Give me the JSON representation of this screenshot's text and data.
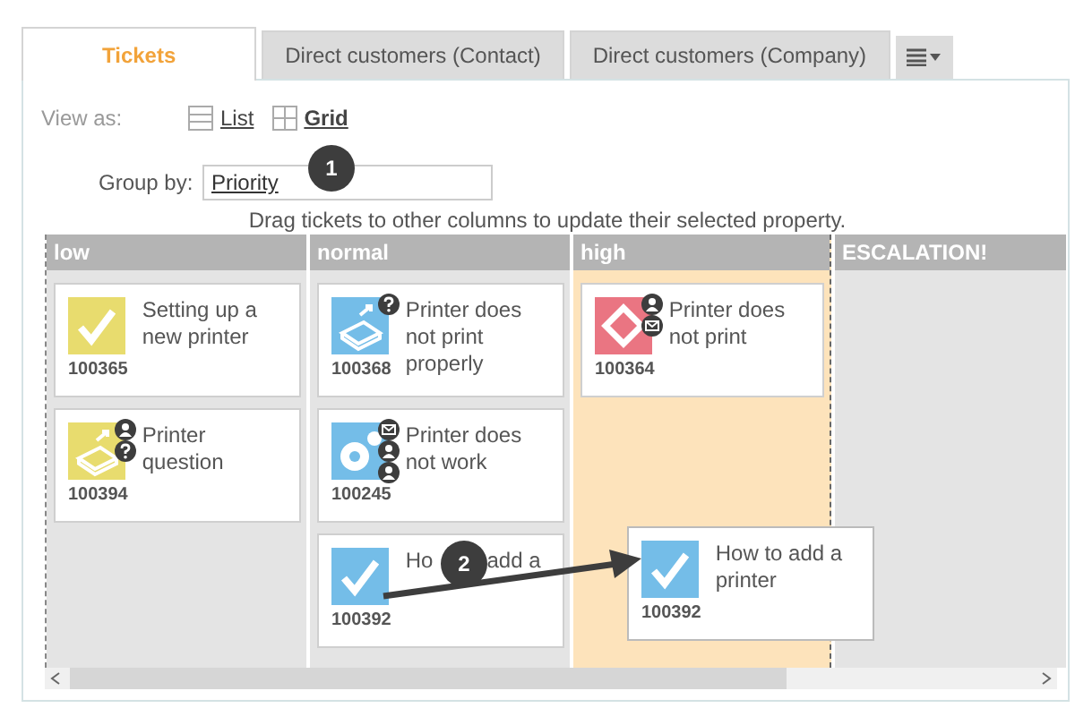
{
  "tabs": [
    {
      "label": "Tickets",
      "selected": true
    },
    {
      "label": "Direct customers (Contact)",
      "selected": false
    },
    {
      "label": "Direct customers (Company)",
      "selected": false
    }
  ],
  "view_as": {
    "label": "View as:",
    "options": [
      {
        "label": "List",
        "kind": "list",
        "selected": false
      },
      {
        "label": "Grid",
        "kind": "grid",
        "selected": true
      }
    ]
  },
  "group_by": {
    "label": "Group by:",
    "value": "Priority",
    "callout": "1"
  },
  "hint": "Drag tickets to other columns to update their selected property.",
  "columns": [
    {
      "name": "low",
      "highlighted": false,
      "tickets": [
        {
          "id": "100365",
          "title": "Setting up a new printer",
          "kind": "check",
          "color": "#e8dc6e"
        },
        {
          "id": "100394",
          "title": "Printer question",
          "kind": "printer",
          "color": "#e8dc6e",
          "badges": [
            {
              "kind": "person"
            },
            {
              "kind": "question"
            }
          ]
        }
      ]
    },
    {
      "name": "normal",
      "highlighted": false,
      "tickets": [
        {
          "id": "100368",
          "title": "Printer does not print properly",
          "kind": "printer",
          "color": "#74bde8",
          "badges": [
            {
              "kind": "question"
            }
          ]
        },
        {
          "id": "100245",
          "title": "Printer does not work",
          "kind": "gear",
          "color": "#74bde8",
          "badges": [
            {
              "kind": "mail"
            },
            {
              "kind": "person"
            },
            {
              "kind": "person"
            }
          ]
        },
        {
          "id": "100392",
          "title_parts": [
            "Ho",
            "add a"
          ],
          "kind": "check",
          "color": "#74bde8"
        }
      ]
    },
    {
      "name": "high",
      "highlighted": true,
      "tickets": [
        {
          "id": "100364",
          "title": "Printer does not print",
          "kind": "diamond",
          "color": "#ea7582",
          "badges": [
            {
              "kind": "person"
            },
            {
              "kind": "mail"
            }
          ]
        }
      ]
    },
    {
      "name": "ESCALATION!",
      "highlighted": false
    }
  ],
  "dragged_card": {
    "id": "100392",
    "title": "How to add a printer",
    "kind": "check",
    "color": "#74bde8",
    "callout": "2"
  }
}
